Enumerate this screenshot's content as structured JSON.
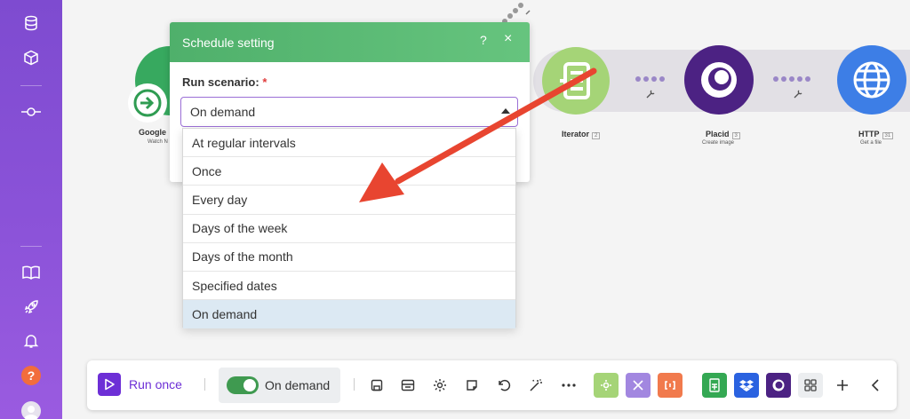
{
  "sidebar": {
    "icons": [
      "database-icon",
      "cube-icon",
      "connection-icon",
      "book-icon",
      "rocket-icon",
      "bell-icon"
    ],
    "help_label": "?"
  },
  "modules": {
    "google": {
      "name": "Google",
      "subtitle": "Watch N"
    },
    "iterator": {
      "name": "Iterator",
      "badge": "2",
      "subtitle": ""
    },
    "placid": {
      "name": "Placid",
      "badge": "3",
      "subtitle": "Create image"
    },
    "http": {
      "name": "HTTP",
      "badge": "31",
      "subtitle": "Get a file"
    }
  },
  "dialog": {
    "title": "Schedule setting",
    "help_button": "?",
    "close_button": "×",
    "field_label": "Run scenario:",
    "required_mark": "*",
    "selected_value": "On demand",
    "options": [
      "At regular intervals",
      "Once",
      "Every day",
      "Days of the week",
      "Days of the month",
      "Specified dates",
      "On demand"
    ],
    "highlighted_option": "On demand"
  },
  "toolbar": {
    "run_label": "Run once",
    "schedule_label": "On demand",
    "schedule_enabled": true,
    "icons": [
      "save-icon",
      "scenario-io-icon",
      "settings-icon",
      "notes-icon",
      "undo-icon",
      "magic-wand-icon",
      "more-icon"
    ],
    "tools": [
      "tools-tile-icon",
      "flow-control-tile-icon",
      "text-parser-tile-icon",
      "sheets-tile-icon",
      "dropbox-tile-icon",
      "placid-tile-icon",
      "grid-tile-icon",
      "add-icon",
      "collapse-icon"
    ]
  },
  "colors": {
    "sidebar": "#8a52d8",
    "dialog_header": "#5cb974",
    "accent": "#6d2fd6",
    "arrow": "#e84530",
    "iterator": "#9fd16f",
    "placid": "#4c2283",
    "http": "#3d7ee6"
  }
}
